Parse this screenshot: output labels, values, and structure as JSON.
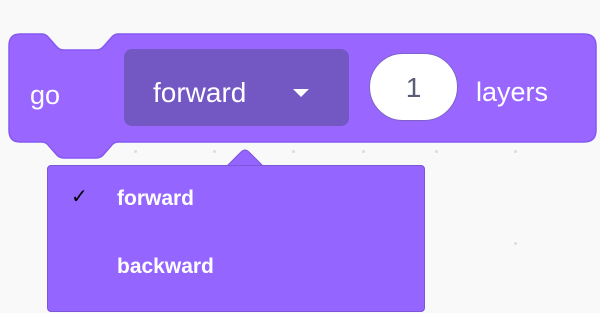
{
  "block": {
    "prefix": "go",
    "dropdown_value": "forward",
    "number_value": "1",
    "suffix": "layers",
    "color": "#9966ff",
    "field_color": "#7358c4"
  },
  "menu": {
    "check_mark": "✓",
    "items": [
      {
        "label": "forward",
        "selected": true
      },
      {
        "label": "backward",
        "selected": false
      }
    ]
  },
  "icons": {
    "dropdown": "caret-down-icon",
    "selected": "checkmark-icon"
  }
}
